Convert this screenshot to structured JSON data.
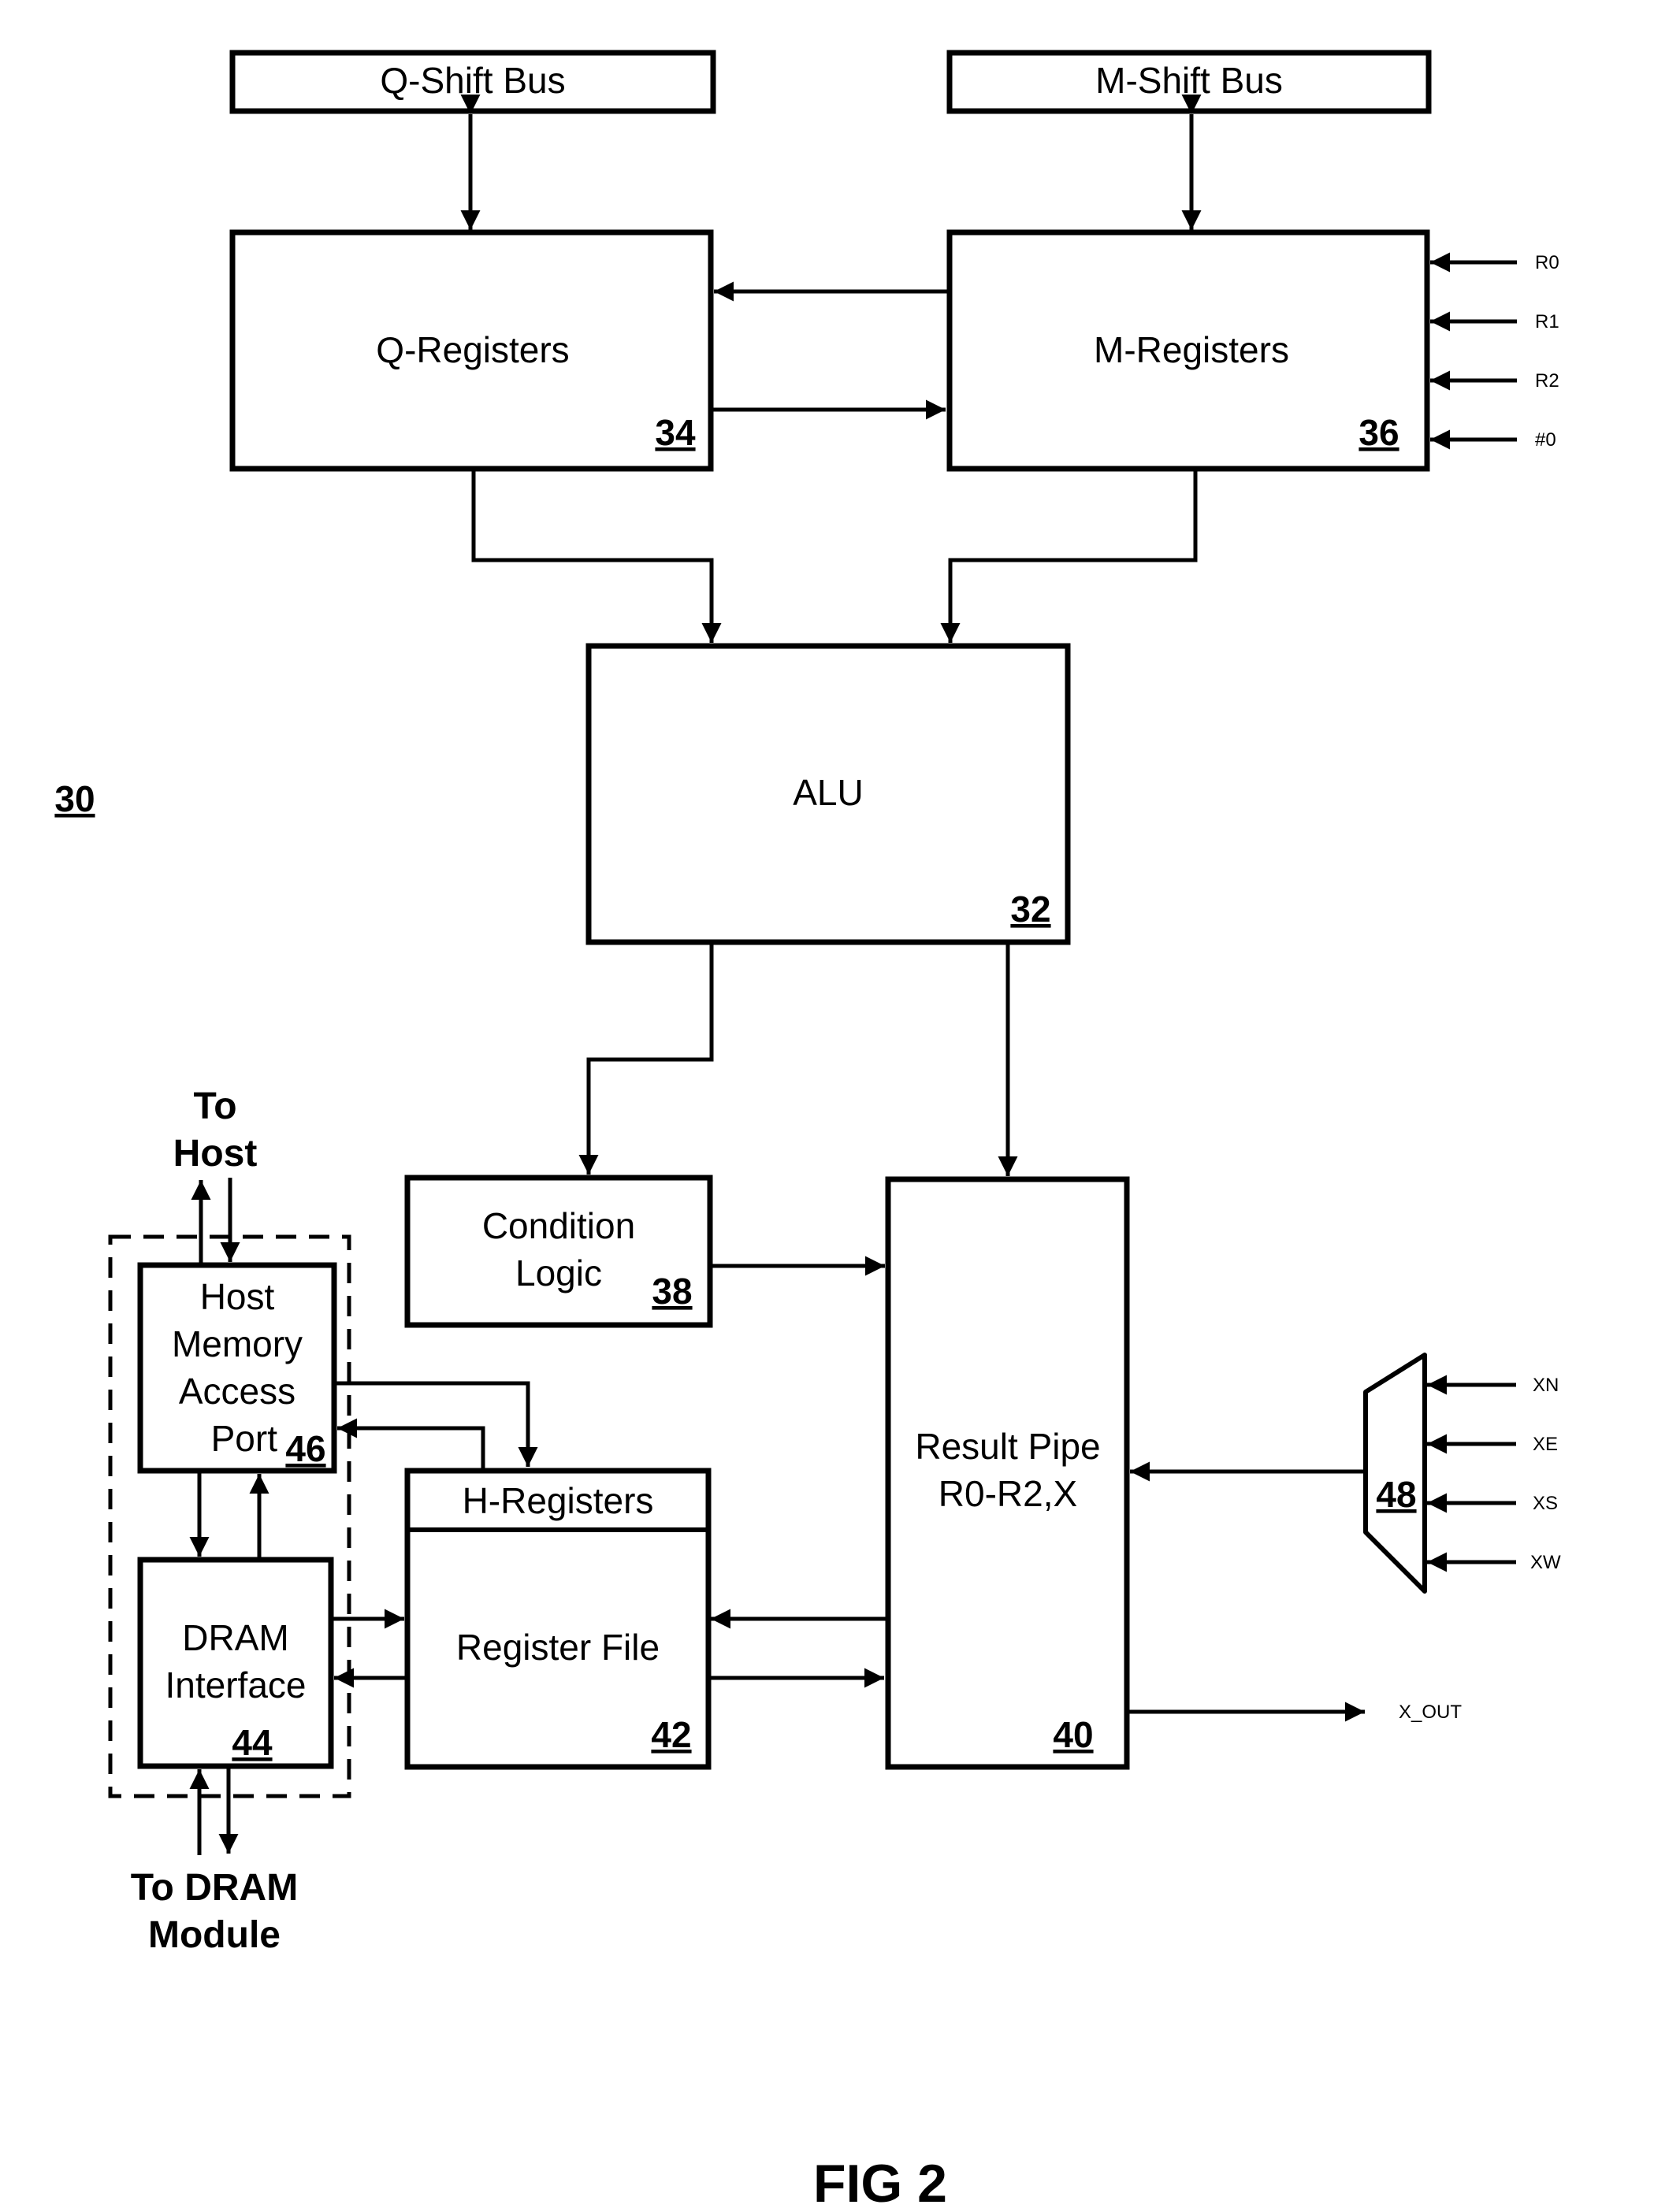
{
  "figure": {
    "ref": "30",
    "caption": "FIG 2"
  },
  "blocks": {
    "q_shift_bus": {
      "label": "Q-Shift Bus"
    },
    "m_shift_bus": {
      "label": "M-Shift Bus"
    },
    "q_registers": {
      "label": "Q-Registers",
      "ref": "34"
    },
    "m_registers": {
      "label": "M-Registers",
      "ref": "36"
    },
    "alu": {
      "label": "ALU",
      "ref": "32"
    },
    "condition_logic": {
      "line1": "Condition",
      "line2": "Logic",
      "ref": "38"
    },
    "result_pipe": {
      "line1": "Result Pipe",
      "line2": "R0-R2,X",
      "ref": "40"
    },
    "h_registers": {
      "label": "H-Registers"
    },
    "register_file": {
      "label": "Register File",
      "ref": "42"
    },
    "dram_interface": {
      "line1": "DRAM",
      "line2": "Interface",
      "ref": "44"
    },
    "host_memory_access_port": {
      "line1": "Host",
      "line2": "Memory",
      "line3": "Access",
      "line4": "Port",
      "ref": "46"
    },
    "mux": {
      "ref": "48"
    }
  },
  "signals": {
    "m_inputs": [
      "R0",
      "R1",
      "R2",
      "#0"
    ],
    "mux_inputs": [
      "XN",
      "XE",
      "XS",
      "XW"
    ],
    "output": "X_OUT"
  },
  "external": {
    "to_host": {
      "line1": "To",
      "line2": "Host"
    },
    "to_dram": {
      "line1": "To DRAM",
      "line2": "Module"
    }
  }
}
